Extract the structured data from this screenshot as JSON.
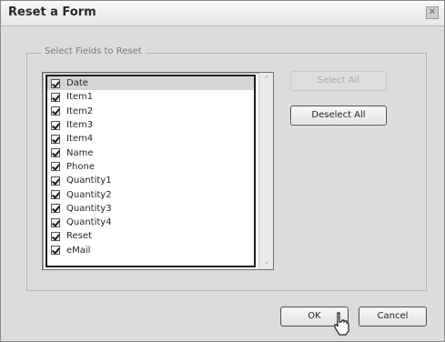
{
  "dialog": {
    "title": "Reset a Form",
    "close_glyph": "✕"
  },
  "group": {
    "legend": "Select Fields to Reset"
  },
  "fields": [
    {
      "label": "Date",
      "checked": true,
      "selected": true
    },
    {
      "label": "Item1",
      "checked": true
    },
    {
      "label": "Item2",
      "checked": true
    },
    {
      "label": "Item3",
      "checked": true
    },
    {
      "label": "Item4",
      "checked": true
    },
    {
      "label": "Name",
      "checked": true
    },
    {
      "label": "Phone",
      "checked": true
    },
    {
      "label": "Quantity1",
      "checked": true
    },
    {
      "label": "Quantity2",
      "checked": true
    },
    {
      "label": "Quantity3",
      "checked": true
    },
    {
      "label": "Quantity4",
      "checked": true
    },
    {
      "label": "Reset",
      "checked": true
    },
    {
      "label": "eMail",
      "checked": true
    }
  ],
  "scrollbar": {
    "up_glyph": "⌃",
    "down_glyph": "⌄"
  },
  "buttons": {
    "select_all": "Select All",
    "deselect_all": "Deselect All",
    "ok": "OK",
    "cancel": "Cancel"
  },
  "colors": {
    "window_bg": "#dcdcdc",
    "list_bg": "#ffffff",
    "disabled_text": "#a8a8a8"
  }
}
